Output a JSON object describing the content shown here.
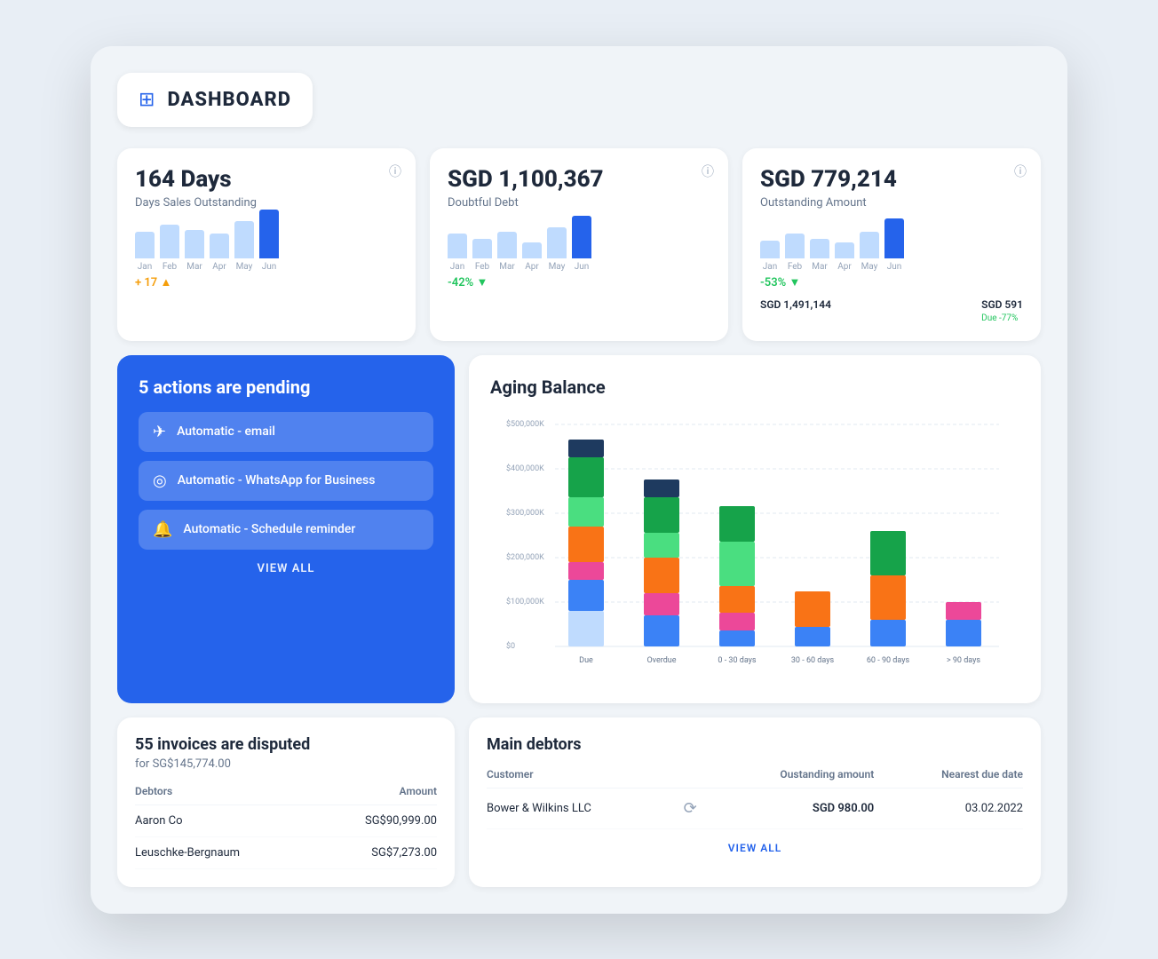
{
  "header": {
    "icon": "⊞",
    "title": "DASHBOARD"
  },
  "stat_cards": [
    {
      "id": "dso",
      "value": "164 Days",
      "label": "Days Sales Outstanding",
      "trend": "+ 17",
      "trend_dir": "up",
      "bars": [
        30,
        38,
        32,
        28,
        42,
        55
      ],
      "months": [
        "Jan",
        "Feb",
        "Mar",
        "Apr",
        "May",
        "Jun"
      ]
    },
    {
      "id": "doubtful",
      "value": "SGD 1,100,367",
      "label": "Doubtful Debt",
      "trend": "-42%",
      "trend_dir": "down",
      "bars": [
        28,
        22,
        30,
        18,
        35,
        48
      ],
      "months": [
        "Jan",
        "Feb",
        "Mar",
        "Apr",
        "May",
        "Jun"
      ]
    },
    {
      "id": "outstanding",
      "value": "SGD 779,214",
      "label": "Outstanding Amount",
      "trend": "-53%",
      "trend_dir": "down",
      "extra_left_label": "SGD 1,491,144",
      "extra_right_label": "SGD 591",
      "extra_right_sub": "Due -77%",
      "bars": [
        20,
        28,
        22,
        18,
        30,
        45
      ],
      "months": [
        "Jan",
        "Feb",
        "Mar",
        "Apr",
        "May",
        "Jun"
      ]
    }
  ],
  "actions_card": {
    "title": "5 actions are pending",
    "items": [
      {
        "icon": "✈",
        "label": "Automatic - email"
      },
      {
        "icon": "◎",
        "label": "Automatic - WhatsApp for Business"
      },
      {
        "icon": "🔔",
        "label": "Automatic - Schedule reminder"
      }
    ],
    "view_all_label": "VIEW ALL"
  },
  "aging_balance": {
    "title": "Aging Balance",
    "categories": [
      "Due",
      "Overdue",
      "0 - 30 days",
      "30 - 60 days",
      "60 - 90 days",
      "> 90 days"
    ],
    "series": {
      "dark_navy": [
        80,
        60,
        0,
        0,
        0,
        0
      ],
      "dark_green": [
        90,
        80,
        80,
        0,
        100,
        0
      ],
      "mid_green": [
        70,
        50,
        100,
        0,
        0,
        0
      ],
      "orange": [
        80,
        70,
        60,
        80,
        80,
        0
      ],
      "pink": [
        40,
        50,
        40,
        0,
        0,
        40
      ],
      "blue": [
        60,
        60,
        30,
        40,
        60,
        60
      ],
      "light_blue": [
        80,
        0,
        0,
        0,
        0,
        0
      ]
    },
    "y_labels": [
      "$500,000K",
      "$400,000K",
      "$300,000K",
      "$200,000K",
      "$100,000K",
      "$0"
    ]
  },
  "disputed": {
    "title": "55 invoices are disputed",
    "sub": "for SG$145,774.00",
    "headers": [
      "Debtors",
      "Amount"
    ],
    "rows": [
      {
        "debtor": "Aaron Co",
        "amount": "SG$90,999.00"
      },
      {
        "debtor": "Leuschke-Bergnaum",
        "amount": "SG$7,273.00"
      }
    ]
  },
  "main_debtors": {
    "title": "Main debtors",
    "headers": [
      "Customer",
      "",
      "Oustanding amount",
      "Nearest due date"
    ],
    "rows": [
      {
        "customer": "Bower & Wilkins LLC",
        "icon": "sync",
        "amount": "SGD 980.00",
        "due_date": "03.02.2022"
      }
    ],
    "view_all_label": "VIEW ALL"
  }
}
